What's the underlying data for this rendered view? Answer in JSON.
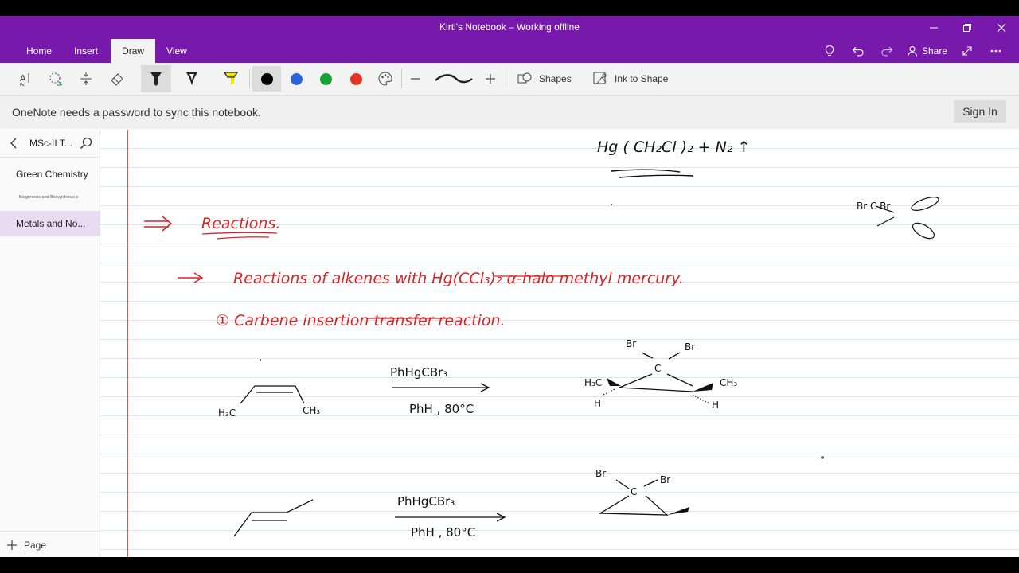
{
  "window": {
    "title": "Kirti's Notebook – Working offline"
  },
  "tabs": [
    {
      "label": "Home"
    },
    {
      "label": "Insert"
    },
    {
      "label": "Draw"
    },
    {
      "label": "View"
    }
  ],
  "header_actions": {
    "share_label": "Share"
  },
  "toolbar": {
    "colors": [
      "#000000",
      "#2b64d8",
      "#17a33a",
      "#e33425"
    ],
    "shapes_label": "Shapes",
    "ink_to_shape_label": "Ink to Shape"
  },
  "notice": {
    "message": "OneNote needs a password to sync this notebook.",
    "signin_label": "Sign In"
  },
  "sidebar": {
    "notebook_title": "MSc-II T...",
    "sections": [
      {
        "label": "Green Chemistry"
      },
      {
        "label": "Biogenesis and Biosynthesis c"
      },
      {
        "label": "Metals and No..."
      }
    ],
    "add_page_label": "Page"
  },
  "ink": {
    "formula_top": "Hg ( CH₂Cl )₂  +  N₂ ↑",
    "carbene_label": "Br  C  Br",
    "reactions_heading": "Reactions.",
    "reactions_line": "Reactions of alkenes with Hg(CCl₃)₂ α-halo methyl mercury.",
    "item_1": "① Carbene insertion transfer reaction.",
    "reagent_1": "PhHgCBr₃",
    "conditions_1": "PhH , 80°C",
    "reagent_2": "PhHgCBr₃",
    "conditions_2": "PhH , 80°C",
    "alkene_1_left": "H₃C",
    "alkene_1_right": "CH₃",
    "product_labels": [
      "Br",
      "Br",
      "C",
      "H₃C",
      "CH₃",
      "H",
      "H"
    ],
    "product_2_labels": [
      "Br",
      "Br",
      "C"
    ]
  }
}
